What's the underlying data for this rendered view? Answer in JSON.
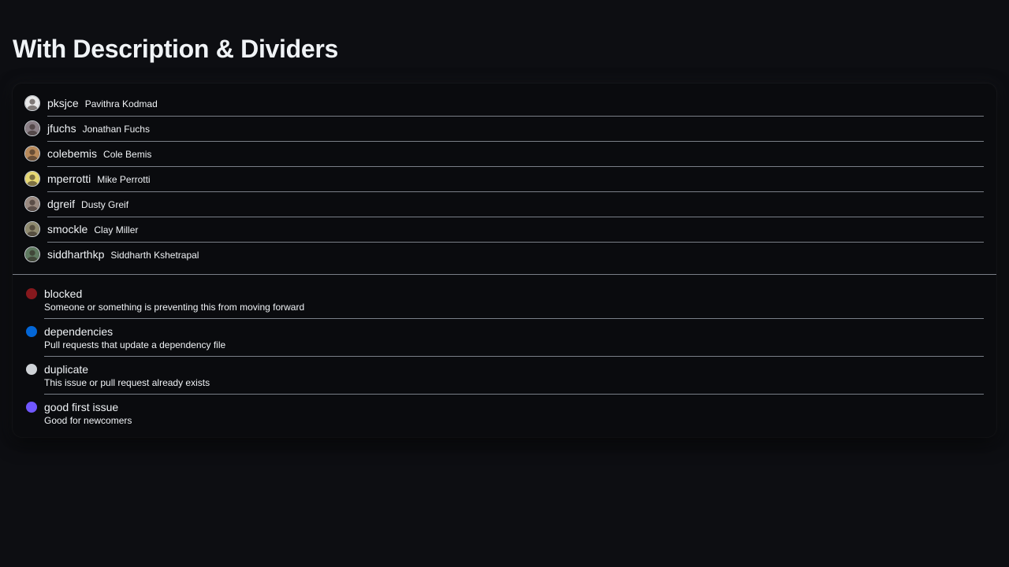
{
  "page": {
    "title": "With Description & Dividers"
  },
  "users": [
    {
      "login": "pksjce",
      "name": "Pavithra Kodmad",
      "avatar_icon": "avatar-pksjce-icon",
      "avatar_bg": "#e8e8e8"
    },
    {
      "login": "jfuchs",
      "name": "Jonathan Fuchs",
      "avatar_icon": "avatar-jfuchs-icon",
      "avatar_bg": "#8a7f86"
    },
    {
      "login": "colebemis",
      "name": "Cole Bemis",
      "avatar_icon": "avatar-colebemis-icon",
      "avatar_bg": "#b98a5a"
    },
    {
      "login": "mperrotti",
      "name": "Mike Perrotti",
      "avatar_icon": "avatar-mperrotti-icon",
      "avatar_bg": "#e6d873"
    },
    {
      "login": "dgreif",
      "name": "Dusty Greif",
      "avatar_icon": "avatar-dgreif-icon",
      "avatar_bg": "#9a8a80"
    },
    {
      "login": "smockle",
      "name": "Clay Miller",
      "avatar_icon": "avatar-smockle-icon",
      "avatar_bg": "#8f8a6f"
    },
    {
      "login": "siddharthkp",
      "name": "Siddharth Kshetrapal",
      "avatar_icon": "avatar-siddharthkp-icon",
      "avatar_bg": "#5f7a60"
    }
  ],
  "labels": [
    {
      "name": "blocked",
      "description": "Someone or something is preventing this from moving forward",
      "color": "#86181d"
    },
    {
      "name": "dependencies",
      "description": "Pull requests that update a dependency file",
      "color": "#0366d6"
    },
    {
      "name": "duplicate",
      "description": "This issue or pull request already exists",
      "color": "#cfd3d7"
    },
    {
      "name": "good first issue",
      "description": "Good for newcomers",
      "color": "#7057ff"
    }
  ],
  "colors": {
    "background": "#0d0e12",
    "card": "#0a0b0e",
    "divider": "#7a7f87",
    "text": "#f0f3f6"
  }
}
